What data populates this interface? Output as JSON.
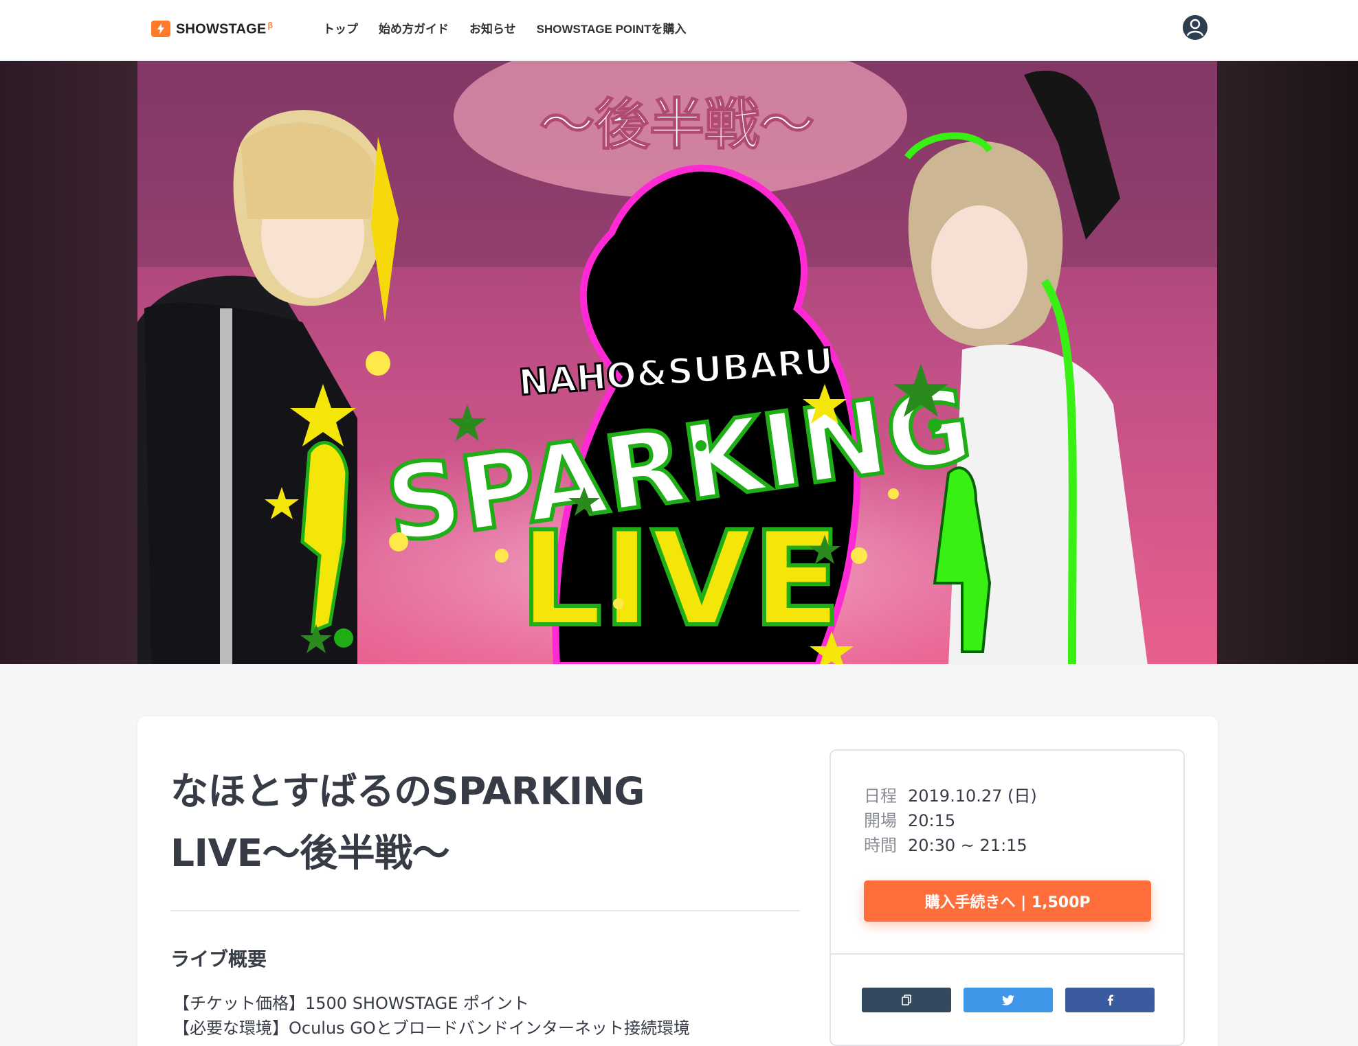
{
  "header": {
    "logo_text": "SHOWSTAGE",
    "logo_beta": "β",
    "nav": [
      "トップ",
      "始め方ガイド",
      "お知らせ",
      "SHOWSTAGE POINTを購入"
    ]
  },
  "hero": {
    "banner_top": "〜後半戦〜",
    "banner_names": "NAHO&SUBARU",
    "banner_sparking": "SPARKING",
    "banner_live": "LIVE"
  },
  "event": {
    "title": "なほとすばるのSPARKING LIVE〜後半戦〜",
    "section_title": "ライブ概要",
    "description": [
      "【チケット価格】1500 SHOWSTAGE ポイント",
      "【必要な環境】Oculus GOとブロードバンドインターネット接続環境"
    ]
  },
  "schedule": {
    "date_label": "日程",
    "date_value": "2019.10.27 (日)",
    "open_label": "開場",
    "open_value": "20:15",
    "time_label": "時間",
    "time_value": "20:30 ~ 21:15"
  },
  "purchase": {
    "button_label": "購入手続きへ | 1,500P"
  },
  "colors": {
    "accent": "#ff6d3b",
    "copy_button": "#34495e",
    "twitter_button": "#3e97e8",
    "facebook_button": "#3b5ba0"
  }
}
